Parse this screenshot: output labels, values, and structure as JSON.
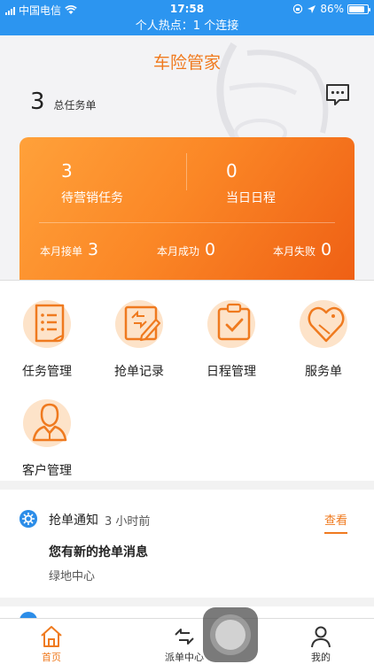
{
  "status_bar": {
    "carrier": "中国电信",
    "time": "17:58",
    "battery": "86%",
    "battery_level": 0.86
  },
  "hotspot_banner": "个人热点：1 个连接",
  "header": {
    "title": "车险管家",
    "task_count": "3",
    "task_label": "总任务单"
  },
  "summary_card": {
    "pending_count": "3",
    "pending_label": "待营销任务",
    "schedule_count": "0",
    "schedule_label": "当日日程",
    "month_orders_label": "本月接单",
    "month_orders": "3",
    "month_success_label": "本月成功",
    "month_success": "0",
    "month_fail_label": "本月失败",
    "month_fail": "0"
  },
  "grid": [
    {
      "label": "任务管理",
      "icon": "task-list-icon"
    },
    {
      "label": "抢单记录",
      "icon": "grab-record-icon"
    },
    {
      "label": "日程管理",
      "icon": "schedule-icon"
    },
    {
      "label": "服务单",
      "icon": "service-tag-icon"
    },
    {
      "label": "客户管理",
      "icon": "customer-icon"
    }
  ],
  "notice": {
    "title": "抢单通知",
    "time": "3 小时前",
    "view_label": "查看",
    "headline": "您有新的抢单消息",
    "body": "绿地中心"
  },
  "tabs": [
    {
      "label": "首页",
      "icon": "home-icon"
    },
    {
      "label": "派单中心",
      "icon": "dispatch-icon"
    },
    {
      "label": "我的",
      "icon": "user-icon"
    }
  ],
  "colors": {
    "accent": "#ef7a1f",
    "status_blue": "#2c95f0"
  }
}
